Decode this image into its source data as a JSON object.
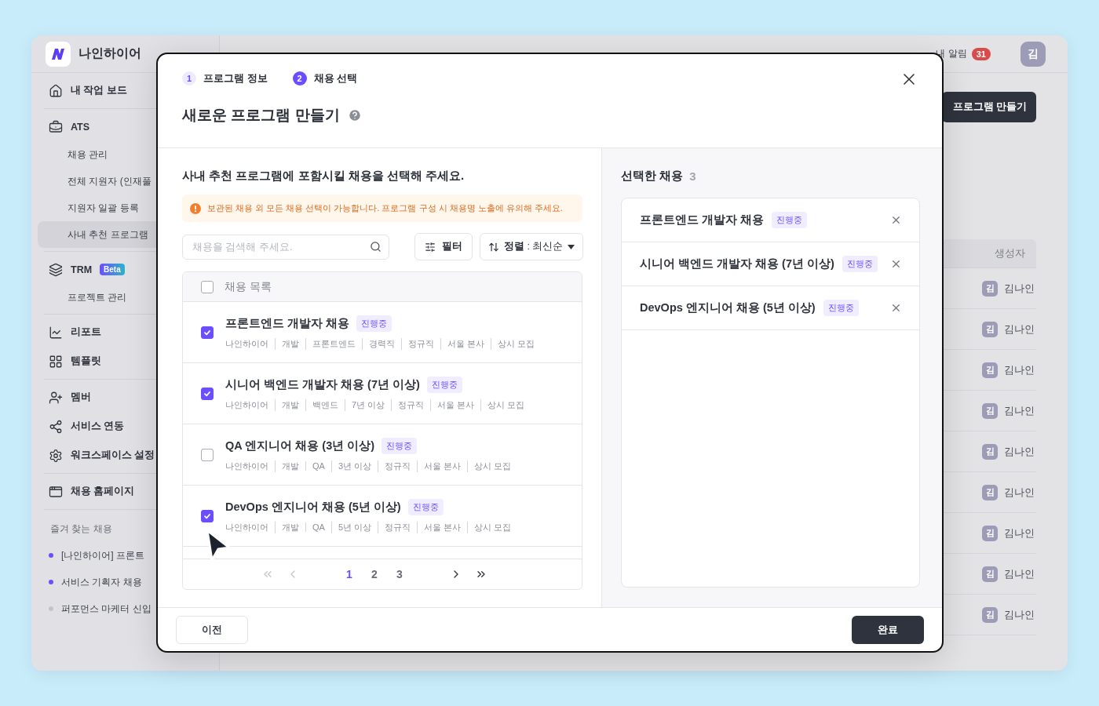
{
  "app": {
    "brand": "나인하이어",
    "nav_groups": [
      [
        {
          "label": "내 작업 보드",
          "selected": false
        }
      ],
      [
        {
          "label": "ATS",
          "selected": false,
          "children": [
            {
              "label": "채용 관리",
              "selected": false
            },
            {
              "label": "전체 지원자 (인재풀",
              "selected": false
            },
            {
              "label": "지원자 일괄 등록",
              "selected": false
            },
            {
              "label": "사내 추천 프로그램",
              "selected": true
            }
          ]
        }
      ],
      [
        {
          "label": "TRM",
          "badge": "Beta",
          "selected": false,
          "children": [
            {
              "label": "프로젝트 관리",
              "selected": false
            }
          ]
        }
      ],
      [
        {
          "label": "리포트",
          "selected": false
        },
        {
          "label": "템플릿",
          "selected": false
        }
      ],
      [
        {
          "label": "멤버",
          "selected": false
        },
        {
          "label": "서비스 연동",
          "selected": false
        },
        {
          "label": "워크스페이스 설정",
          "selected": false
        }
      ],
      [
        {
          "label": "채용 홈페이지",
          "selected": false
        }
      ]
    ],
    "favorites": {
      "title": "즐겨 찾는 채용",
      "items": [
        {
          "label": "[나인하이어] 프론트",
          "color": "#6b4eff"
        },
        {
          "label": "서비스 기획자 채용",
          "color": "#6b4eff"
        },
        {
          "label": "퍼포먼스 마케터 신입",
          "color": "#c4c4cc"
        }
      ]
    }
  },
  "topbar": {
    "notifications_label": "내 알림",
    "notifications_count": "31",
    "avatar": "김"
  },
  "page": {
    "create_button": "프로그램 만들기",
    "table": {
      "columns": [
        "생성자"
      ],
      "rows": [
        {
          "avatar": "김",
          "creator": "김나인"
        },
        {
          "avatar": "김",
          "creator": "김나인"
        },
        {
          "avatar": "김",
          "creator": "김나인"
        },
        {
          "avatar": "김",
          "creator": "김나인"
        },
        {
          "avatar": "김",
          "creator": "김나인"
        },
        {
          "avatar": "김",
          "creator": "김나인"
        },
        {
          "avatar": "김",
          "creator": "김나인"
        },
        {
          "avatar": "김",
          "creator": "김나인"
        },
        {
          "avatar": "김",
          "creator": "김나인"
        }
      ]
    }
  },
  "modal": {
    "steps": [
      {
        "number": "1",
        "label": "프로그램 정보",
        "selected": false
      },
      {
        "number": "2",
        "label": "채용 선택",
        "selected": true
      }
    ],
    "title": "새로운 프로그램 만들기",
    "instruction": "사내 추천 프로그램에 포함시킬 채용을 선택해 주세요.",
    "notice": "보관된 채용 외 모든 채용 선택이 가능합니다. 프로그램 구성 시 채용명 노출에 유의해 주세요.",
    "search": {
      "placeholder": "채용을 검색해 주세요."
    },
    "filter_button": "필터",
    "sort_button": "**정렬** : 최신순",
    "list": {
      "header": "채용 목록",
      "all_checked": false,
      "jobs": [
        {
          "title": "프론트엔드 개발자 채용",
          "status": "진행중",
          "checked": true,
          "meta": [
            "나인하이어",
            "개발",
            "프론트엔드",
            "경력직",
            "정규직",
            "서울 본사",
            "상시 모집"
          ]
        },
        {
          "title": "시니어 백엔드 개발자 채용 (7년 이상)",
          "status": "진행중",
          "checked": true,
          "meta": [
            "나인하이어",
            "개발",
            "백엔드",
            "7년 이상",
            "정규직",
            "서울 본사",
            "상시 모집"
          ]
        },
        {
          "title": "QA 엔지니어 채용 (3년 이상)",
          "status": "진행중",
          "checked": false,
          "meta": [
            "나인하이어",
            "개발",
            "QA",
            "3년 이상",
            "정규직",
            "서울 본사",
            "상시 모집"
          ]
        },
        {
          "title": "DevOps 엔지니어 채용 (5년 이상)",
          "status": "진행중",
          "checked": true,
          "meta": [
            "나인하이어",
            "개발",
            "QA",
            "5년 이상",
            "정규직",
            "서울 본사",
            "상시 모집"
          ]
        }
      ]
    },
    "pagination": [
      {
        "label": "1",
        "selected": true
      },
      {
        "label": "2",
        "selected": false
      },
      {
        "label": "3",
        "selected": false
      }
    ],
    "selected_panel": {
      "title": "선택한 채용",
      "count": "3",
      "items": [
        {
          "title": "프론트엔드 개발자 채용",
          "status": "진행중"
        },
        {
          "title": "시니어 백엔드 개발자 채용 (7년 이상)",
          "status": "진행중"
        },
        {
          "title": "DevOps 엔지니어 채용 (5년 이상)",
          "status": "진행중"
        }
      ]
    },
    "buttons": {
      "prev": "이전",
      "done": "완료"
    }
  }
}
